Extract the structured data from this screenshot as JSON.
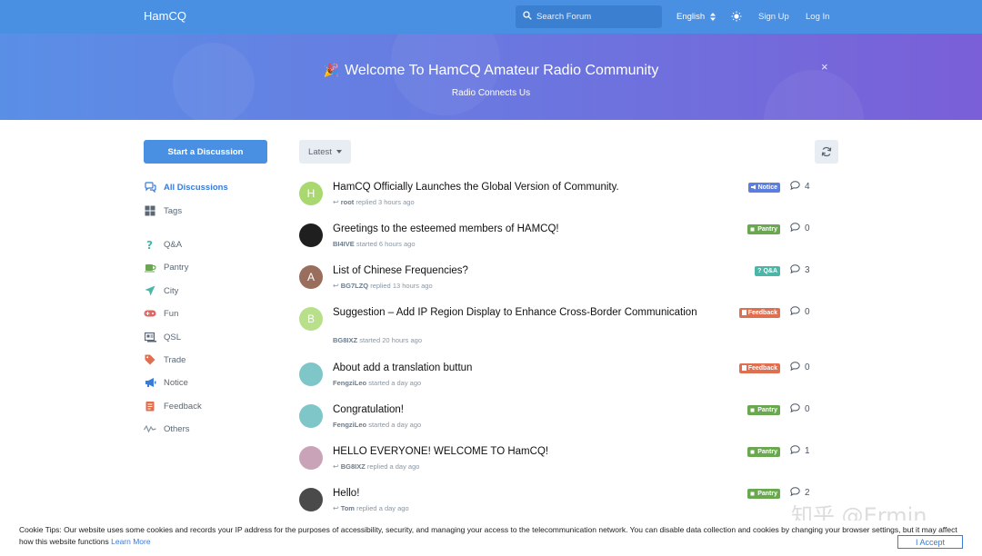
{
  "header": {
    "brand": "HamCQ",
    "search_placeholder": "Search Forum",
    "language": "English",
    "signup": "Sign Up",
    "login": "Log In"
  },
  "hero": {
    "title": "Welcome To HamCQ Amateur Radio Community",
    "subtitle": "Radio Connects Us",
    "close": "×"
  },
  "sidebar": {
    "start_button": "Start a Discussion",
    "items": [
      {
        "label": "All Discussions",
        "icon": "comments-icon",
        "color": "#3a7bd5"
      },
      {
        "label": "Tags",
        "icon": "grid-icon",
        "color": "#5b6774"
      },
      {
        "label": "Q&A",
        "icon": "question-icon",
        "color": "#4bb6a8"
      },
      {
        "label": "Pantry",
        "icon": "mug-icon",
        "color": "#6aa84f"
      },
      {
        "label": "City",
        "icon": "paper-plane-icon",
        "color": "#4bb6a8"
      },
      {
        "label": "Fun",
        "icon": "gamepad-icon",
        "color": "#e06666"
      },
      {
        "label": "QSL",
        "icon": "postcard-icon",
        "color": "#5b6774"
      },
      {
        "label": "Trade",
        "icon": "tag-icon",
        "color": "#e06f4f"
      },
      {
        "label": "Notice",
        "icon": "megaphone-icon",
        "color": "#3a7bd5"
      },
      {
        "label": "Feedback",
        "icon": "clipboard-icon",
        "color": "#e06f4f"
      },
      {
        "label": "Others",
        "icon": "wave-icon",
        "color": "#8a96a3"
      }
    ]
  },
  "toolbar": {
    "sort_label": "Latest"
  },
  "tags": {
    "Notice": "#5b7fe0",
    "Pantry": "#6aa84f",
    "Q&A": "#4bb6a8",
    "Feedback": "#e06f4f"
  },
  "discussions": [
    {
      "title": "HamCQ Officially Launches the Global Version of Community.",
      "user": "root",
      "action": "replied",
      "time": "3 hours ago",
      "reply": true,
      "tag": "Notice",
      "count": "4",
      "avatar_letter": "H",
      "avatar_color": "#a9d86e"
    },
    {
      "title": "Greetings to the esteemed members of HAMCQ!",
      "user": "BI4IVE",
      "action": "started",
      "time": "6 hours ago",
      "reply": false,
      "tag": "Pantry",
      "count": "0",
      "avatar_letter": "",
      "avatar_color": "#1f1f1f"
    },
    {
      "title": "List of Chinese Frequencies?",
      "user": "BG7LZQ",
      "action": "replied",
      "time": "13 hours ago",
      "reply": true,
      "tag": "Q&A",
      "count": "3",
      "avatar_letter": "A",
      "avatar_color": "#9a6e5c"
    },
    {
      "title": "Suggestion – Add IP Region Display to Enhance Cross-Border Communication",
      "user": "BG8IXZ",
      "action": "started",
      "time": "20 hours ago",
      "reply": false,
      "tag": "Feedback",
      "count": "0",
      "avatar_letter": "B",
      "avatar_color": "#b8df8a"
    },
    {
      "title": "About add a translation buttun",
      "user": "FengziLeo",
      "action": "started",
      "time": "a day ago",
      "reply": false,
      "tag": "Feedback",
      "count": "0",
      "avatar_letter": "",
      "avatar_color": "#7fc6c9"
    },
    {
      "title": "Congratulation!",
      "user": "FengziLeo",
      "action": "started",
      "time": "a day ago",
      "reply": false,
      "tag": "Pantry",
      "count": "0",
      "avatar_letter": "",
      "avatar_color": "#7fc6c9"
    },
    {
      "title": "HELLO EVERYONE! WELCOME TO HamCQ!",
      "user": "BG8IXZ",
      "action": "replied",
      "time": "a day ago",
      "reply": true,
      "tag": "Pantry",
      "count": "1",
      "avatar_letter": "",
      "avatar_color": "#c9a3b8"
    },
    {
      "title": "Hello!",
      "user": "Tom",
      "action": "replied",
      "time": "a day ago",
      "reply": true,
      "tag": "Pantry",
      "count": "2",
      "avatar_letter": "",
      "avatar_color": "#4a4a4a"
    }
  ],
  "cookie": {
    "text": "Cookie Tips: Our website uses some cookies and records your IP address for the purposes of accessibility, security, and managing your access to the telecommunication network. You can disable data collection and cookies by changing your browser settings, but it may affect how this website functions",
    "learn_more": "Learn More",
    "accept": "I Accept"
  },
  "watermark": "知乎 @Ermin"
}
